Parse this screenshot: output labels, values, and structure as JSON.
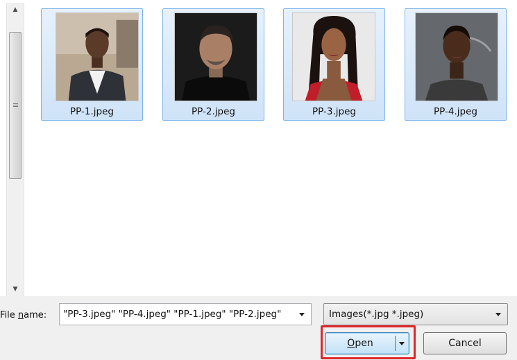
{
  "files": [
    {
      "name": "PP-1.jpeg",
      "selected": true
    },
    {
      "name": "PP-2.jpeg",
      "selected": true
    },
    {
      "name": "PP-3.jpeg",
      "selected": true
    },
    {
      "name": "PP-4.jpeg",
      "selected": true
    }
  ],
  "scrollbar": {
    "up_icon": "triangle-up",
    "down_icon": "triangle-down"
  },
  "file_name": {
    "label": "File name:",
    "value": "\"PP-3.jpeg\" \"PP-4.jpeg\" \"PP-1.jpeg\" \"PP-2.jpeg\""
  },
  "file_type": {
    "selected": "Images(*.jpg *.jpeg)"
  },
  "buttons": {
    "open": "Open",
    "cancel": "Cancel"
  },
  "colors": {
    "selection_border": "#7eb4ea",
    "selection_fill": "#cfe3f8",
    "highlight": "#e0262b"
  }
}
